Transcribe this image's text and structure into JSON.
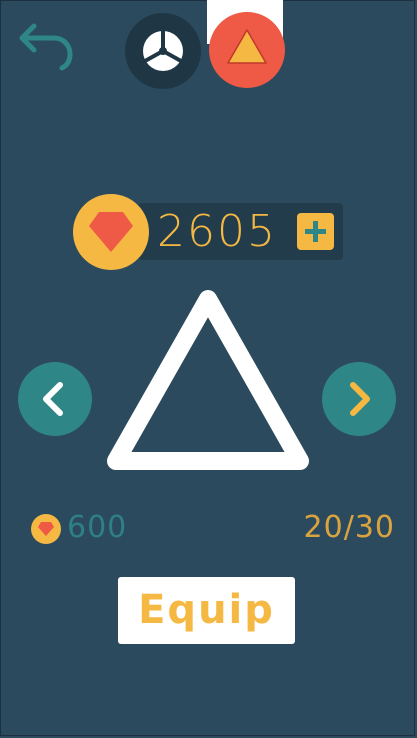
{
  "top_tabs": [
    {
      "icon": "wheel-icon",
      "selected": false
    },
    {
      "icon": "triangle-icon",
      "selected": true
    }
  ],
  "coins": {
    "amount": "2605",
    "icon": "gem-icon",
    "add_icon": "plus-icon"
  },
  "item": {
    "shape": "triangle-outline",
    "price": "600",
    "progress": "20/30"
  },
  "equip_label": "Equip",
  "colors": {
    "background": "#2c4a5d",
    "accent_gold": "#f4b843",
    "accent_red": "#ee5a45",
    "accent_teal": "#2e8686",
    "dark_panel": "#233c4c"
  }
}
